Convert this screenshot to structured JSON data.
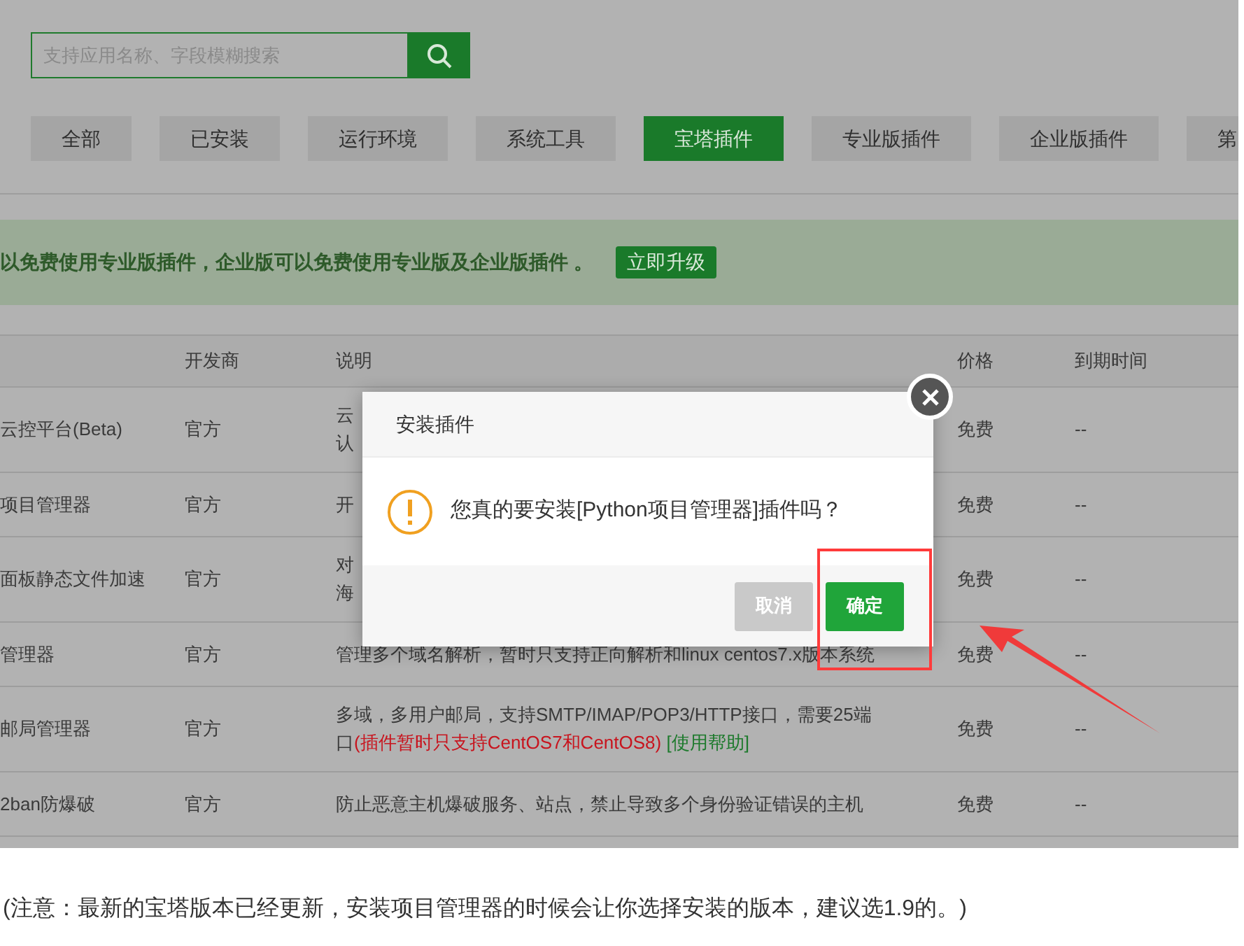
{
  "search": {
    "placeholder": "支持应用名称、字段模糊搜索"
  },
  "tabs": [
    {
      "label": "全部",
      "selected": false
    },
    {
      "label": "已安装",
      "selected": false
    },
    {
      "label": "运行环境",
      "selected": false
    },
    {
      "label": "系统工具",
      "selected": false
    },
    {
      "label": "宝塔插件",
      "selected": true
    },
    {
      "label": "专业版插件",
      "selected": false
    },
    {
      "label": "企业版插件",
      "selected": false
    },
    {
      "label": "第",
      "selected": false
    }
  ],
  "banner": {
    "text": "以免费使用专业版插件，企业版可以免费使用专业版及企业版插件 。",
    "button": "立即升级"
  },
  "table": {
    "columns": [
      "",
      "开发商",
      "说明",
      "价格",
      "到期时间"
    ],
    "rows": [
      {
        "name": "云控平台(Beta)",
        "developer": "官方",
        "description": [
          [
            {
              "kind": "plain",
              "text": "云"
            }
          ],
          [
            {
              "kind": "plain",
              "text": "认"
            }
          ]
        ],
        "price": "免费",
        "expiry": "--"
      },
      {
        "name": "项目管理器",
        "developer": "官方",
        "description": [
          [
            {
              "kind": "plain",
              "text": "开"
            }
          ]
        ],
        "price": "免费",
        "expiry": "--"
      },
      {
        "name": "面板静态文件加速",
        "developer": "官方",
        "description": [
          [
            {
              "kind": "plain",
              "text": "对"
            }
          ],
          [
            {
              "kind": "plain",
              "text": "海"
            }
          ]
        ],
        "price": "免费",
        "expiry": "--"
      },
      {
        "name": "管理器",
        "developer": "官方",
        "description": [
          [
            {
              "kind": "plain",
              "text": "管理多个域名解析，暂时只支持正向解析和linux centos7.x版本系统"
            }
          ]
        ],
        "price": "免费",
        "expiry": "--"
      },
      {
        "name": "邮局管理器",
        "developer": "官方",
        "description": [
          [
            {
              "kind": "plain",
              "text": "多域，多用户邮局，支持SMTP/IMAP/POP3/HTTP接口，需要25端"
            }
          ],
          [
            {
              "kind": "plain",
              "text": "口"
            },
            {
              "kind": "warning",
              "text": "(插件暂时只支持CentOS7和CentOS8)"
            },
            {
              "kind": "link",
              "text": " [使用帮助]"
            }
          ]
        ],
        "price": "免费",
        "expiry": "--"
      },
      {
        "name": "2ban防爆破",
        "developer": "官方",
        "description": [
          [
            {
              "kind": "plain",
              "text": "防止恶意主机爆破服务、站点，禁止导致多个身份验证错误的主机"
            }
          ]
        ],
        "price": "免费",
        "expiry": "--"
      }
    ]
  },
  "dialog": {
    "title": "安装插件",
    "message": "您真的要安装[Python项目管理器]插件吗？",
    "buttons": [
      {
        "kind": "cancel",
        "label": "取消"
      },
      {
        "kind": "confirm",
        "label": "确定"
      }
    ]
  },
  "caption": "(注意：最新的宝塔版本已经更新，安装项目管理器的时候会让你选择安装的版本，建议选1.9的。)"
}
